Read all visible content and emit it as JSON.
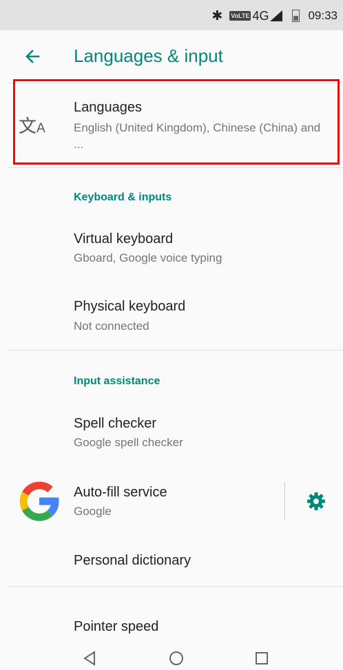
{
  "status_bar": {
    "bluetooth_icon": "bluetooth-icon",
    "volte": "VoLTE",
    "network": "4G",
    "network_sup": "4G",
    "time": "09:33"
  },
  "app_bar": {
    "title": "Languages & input",
    "back_icon": "arrow-back-icon",
    "accent_color": "#00897b"
  },
  "languages": {
    "icon": "translate-icon",
    "title": "Languages",
    "subtitle": "English (United Kingdom), Chinese (China) and ..."
  },
  "keyboard_section": {
    "header": "Keyboard & inputs",
    "items": [
      {
        "title": "Virtual keyboard",
        "subtitle": "Gboard, Google voice typing"
      },
      {
        "title": "Physical keyboard",
        "subtitle": "Not connected"
      }
    ]
  },
  "assist_section": {
    "header": "Input assistance",
    "spell": {
      "title": "Spell checker",
      "subtitle": "Google spell checker"
    },
    "autofill": {
      "title": "Auto-fill service",
      "subtitle": "Google",
      "icon": "google-logo-icon",
      "action_icon": "gear-icon"
    },
    "dictionary": {
      "title": "Personal dictionary"
    }
  },
  "pointer": {
    "title": "Pointer speed"
  },
  "nav_bar": {
    "back": "back-triangle-icon",
    "home": "home-circle-icon",
    "recents": "recents-square-icon"
  },
  "highlight_color": "#e01010"
}
